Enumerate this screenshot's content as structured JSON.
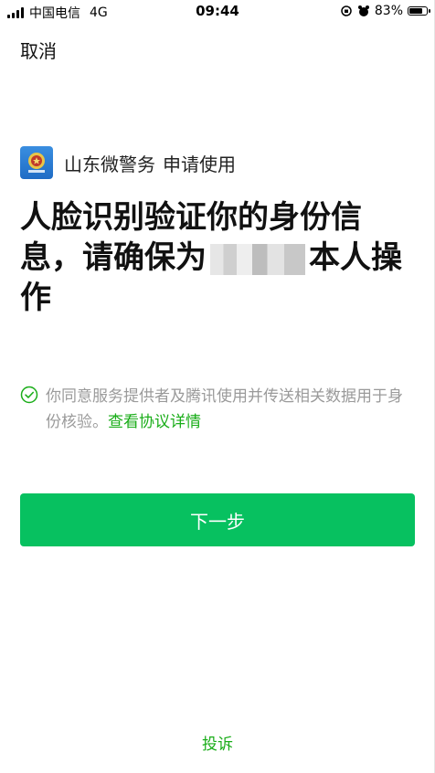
{
  "status_bar": {
    "carrier": "中国电信",
    "network": "4G",
    "time": "09:44",
    "battery": "83%",
    "battery_level": 0.83
  },
  "nav": {
    "cancel_label": "取消"
  },
  "app": {
    "name": "山东微警务",
    "request": "申请使用"
  },
  "headline": {
    "part1": "人脸识别验证你的身份信息，请确保为",
    "part2": "本人操作"
  },
  "agreement": {
    "text": "你同意服务提供者及腾讯使用并传送相关数据用于身份核验。",
    "link": "查看协议详情"
  },
  "next_button": {
    "label": "下一步"
  },
  "footer": {
    "complain_label": "投诉"
  },
  "colors": {
    "primary_green": "#07c160",
    "link_green": "#1aad19",
    "muted_text": "#9a9a9a"
  }
}
